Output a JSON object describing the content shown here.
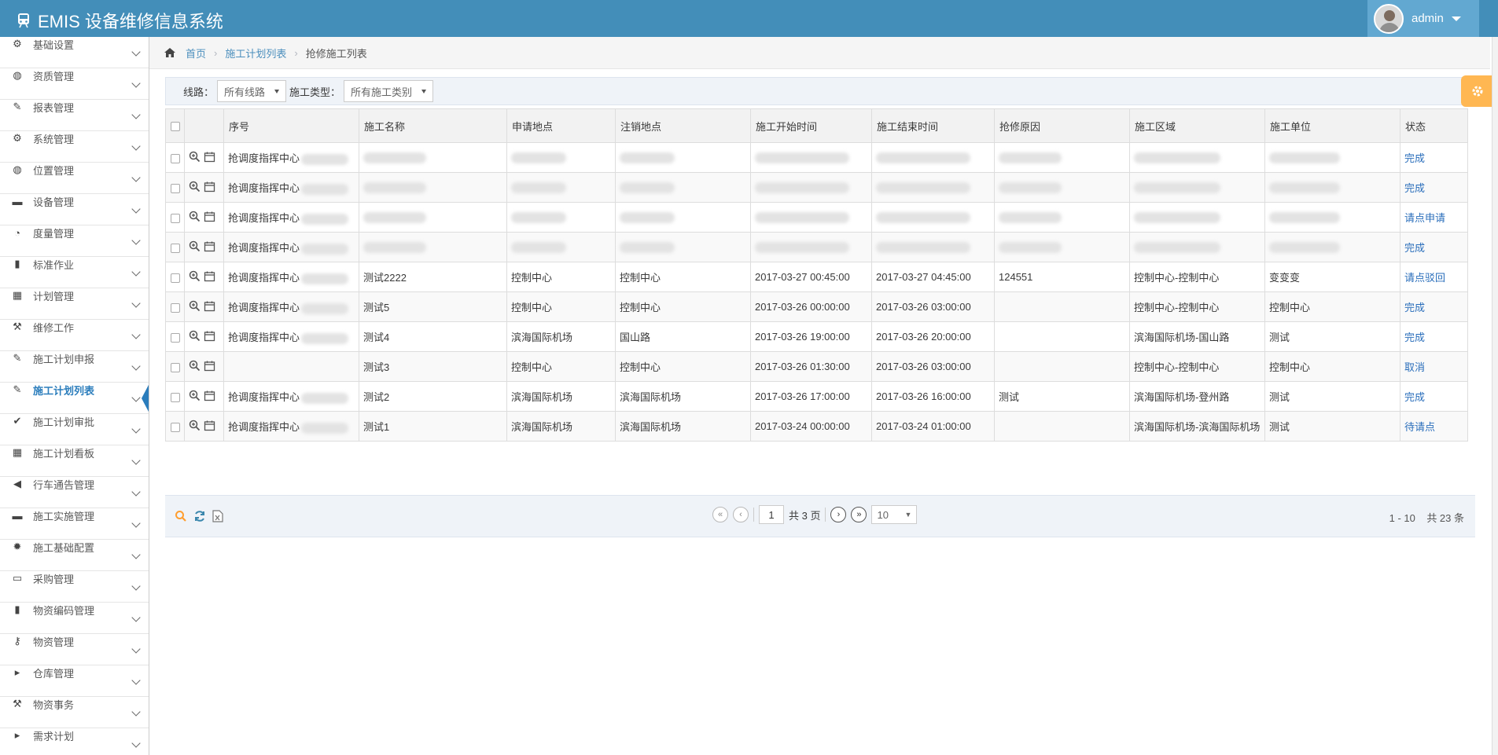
{
  "app": {
    "title": "EMIS 设备维修信息系统",
    "user": "admin"
  },
  "breadcrumb": {
    "home": "首页",
    "parent": "施工计划列表",
    "current": "抢修施工列表"
  },
  "sidebar": {
    "items": [
      {
        "label": "基础设置",
        "icon": "gear-icon"
      },
      {
        "label": "资质管理",
        "icon": "globe-icon"
      },
      {
        "label": "报表管理",
        "icon": "edit-icon"
      },
      {
        "label": "系统管理",
        "icon": "gears-icon"
      },
      {
        "label": "位置管理",
        "icon": "globe-icon"
      },
      {
        "label": "设备管理",
        "icon": "briefcase-icon"
      },
      {
        "label": "度量管理",
        "icon": "dashboard-icon"
      },
      {
        "label": "标准作业",
        "icon": "book-icon"
      },
      {
        "label": "计划管理",
        "icon": "calendar-icon"
      },
      {
        "label": "维修工作",
        "icon": "gavel-icon"
      },
      {
        "label": "施工计划申报",
        "icon": "edit-icon"
      },
      {
        "label": "施工计划列表",
        "icon": "edit-icon"
      },
      {
        "label": "施工计划审批",
        "icon": "check-icon"
      },
      {
        "label": "施工计划看板",
        "icon": "calendar-icon"
      },
      {
        "label": "行车通告管理",
        "icon": "bullhorn-icon"
      },
      {
        "label": "施工实施管理",
        "icon": "briefcase-icon"
      },
      {
        "label": "施工基础配置",
        "icon": "cog-icon"
      },
      {
        "label": "采购管理",
        "icon": "credit-card-icon"
      },
      {
        "label": "物资编码管理",
        "icon": "book-icon"
      },
      {
        "label": "物资管理",
        "icon": "key-icon"
      },
      {
        "label": "仓库管理",
        "icon": "caret-right-icon"
      },
      {
        "label": "物资事务",
        "icon": "gavel-icon"
      },
      {
        "label": "需求计划",
        "icon": "caret-right-icon"
      }
    ]
  },
  "filter": {
    "line_label": "线路：",
    "line_value": "所有线路",
    "type_label": "施工类型：",
    "type_value": "所有施工类别"
  },
  "table": {
    "headers": [
      "序号",
      "施工名称",
      "申请地点",
      "注销地点",
      "施工开始时间",
      "施工结束时间",
      "抢修原因",
      "施工区域",
      "施工单位",
      "状态"
    ],
    "rows": [
      [
        "抢调度指挥中心",
        "",
        "",
        "",
        "",
        "",
        "",
        "",
        "",
        "完成"
      ],
      [
        "抢调度指挥中心",
        "",
        "",
        "",
        "",
        "",
        "",
        "",
        "",
        "完成"
      ],
      [
        "抢调度指挥中心",
        "",
        "",
        "",
        "",
        "",
        "",
        "",
        "",
        "请点申请"
      ],
      [
        "抢调度指挥中心",
        "",
        "",
        "",
        "",
        "",
        "",
        "",
        "",
        "完成"
      ],
      [
        "抢调度指挥中心",
        "测试2222",
        "控制中心",
        "控制中心",
        "2017-03-27 00:45:00",
        "2017-03-27 04:45:00",
        "124551",
        "控制中心-控制中心",
        "变变变",
        "请点驳回"
      ],
      [
        "抢调度指挥中心",
        "测试5",
        "控制中心",
        "控制中心",
        "2017-03-26 00:00:00",
        "2017-03-26 03:00:00",
        "",
        "控制中心-控制中心",
        "控制中心",
        "完成"
      ],
      [
        "抢调度指挥中心",
        "测试4",
        "滨海国际机场",
        "国山路",
        "2017-03-26 19:00:00",
        "2017-03-26 20:00:00",
        "",
        "滨海国际机场-国山路",
        "测试",
        "完成"
      ],
      [
        "",
        "测试3",
        "控制中心",
        "控制中心",
        "2017-03-26 01:30:00",
        "2017-03-26 03:00:00",
        "",
        "控制中心-控制中心",
        "控制中心",
        "取消"
      ],
      [
        "抢调度指挥中心",
        "测试2",
        "滨海国际机场",
        "滨海国际机场",
        "2017-03-26 17:00:00",
        "2017-03-26 16:00:00",
        "测试",
        "滨海国际机场-登州路",
        "测试",
        "完成"
      ],
      [
        "抢调度指挥中心",
        "测试1",
        "滨海国际机场",
        "滨海国际机场",
        "2017-03-24 00:00:00",
        "2017-03-24 01:00:00",
        "",
        "滨海国际机场-滨海国际机场",
        "测试",
        "待请点"
      ]
    ]
  },
  "pager": {
    "page": "1",
    "total_pages": "共 3 页",
    "page_size": "10",
    "range": "1 - 10",
    "total": "共 23 条"
  }
}
